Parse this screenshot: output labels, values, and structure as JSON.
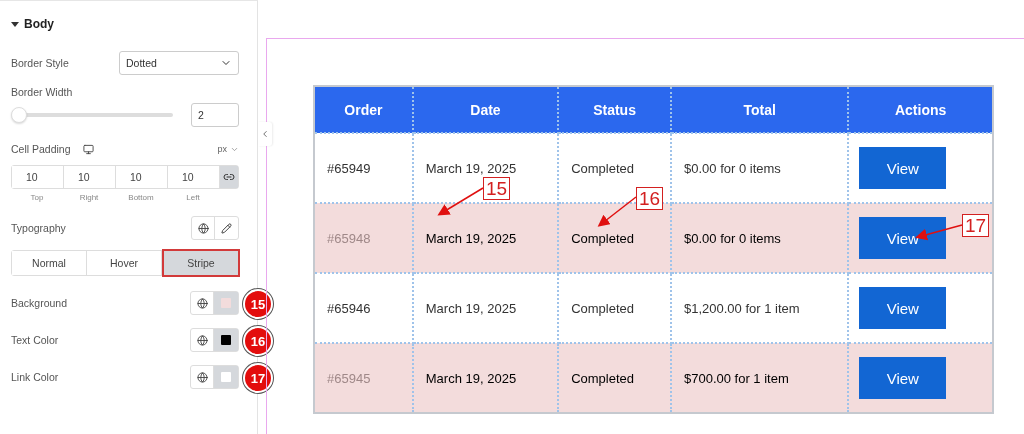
{
  "panel": {
    "section": {
      "title": "Body",
      "expanded": true
    },
    "border_style": {
      "label": "Border Style",
      "value": "Dotted"
    },
    "border_width": {
      "label": "Border Width",
      "level": 0,
      "value": "2"
    },
    "cell_padding": {
      "label": "Cell Padding",
      "unit": "px",
      "linked": true,
      "fields": [
        {
          "value": "10",
          "label": "Top"
        },
        {
          "value": "10",
          "label": "Right"
        },
        {
          "value": "10",
          "label": "Bottom"
        },
        {
          "value": "10",
          "label": "Left"
        }
      ]
    },
    "typography": {
      "label": "Typography"
    },
    "tabs": [
      {
        "label": "Normal",
        "selected": false
      },
      {
        "label": "Hover",
        "selected": false
      },
      {
        "label": "Stripe",
        "selected": true
      }
    ],
    "colors": [
      {
        "label": "Background",
        "color": "#f3dcdc",
        "badge": "15"
      },
      {
        "label": "Text Color",
        "color": "#000000",
        "badge": "16"
      },
      {
        "label": "Link Color",
        "color": "#ffffff",
        "badge": "17"
      }
    ]
  },
  "table": {
    "columns": [
      "Order",
      "Date",
      "Status",
      "Total",
      "Actions"
    ],
    "rows": [
      {
        "order": "#65949",
        "date": "March 19, 2025",
        "status": "Completed",
        "total": "$0.00 for 0 items",
        "action": "View",
        "striped": false
      },
      {
        "order": "#65948",
        "date": "March 19, 2025",
        "status": "Completed",
        "total": "$0.00 for 0 items",
        "action": "View",
        "striped": true
      },
      {
        "order": "#65946",
        "date": "March 19, 2025",
        "status": "Completed",
        "total": "$1,200.00 for 1 item",
        "action": "View",
        "striped": false
      },
      {
        "order": "#65945",
        "date": "March 19, 2025",
        "status": "Completed",
        "total": "$700.00 for 1 item",
        "action": "View",
        "striped": true
      }
    ]
  },
  "annotations": [
    {
      "label": "15"
    },
    {
      "label": "16"
    },
    {
      "label": "17"
    }
  ]
}
